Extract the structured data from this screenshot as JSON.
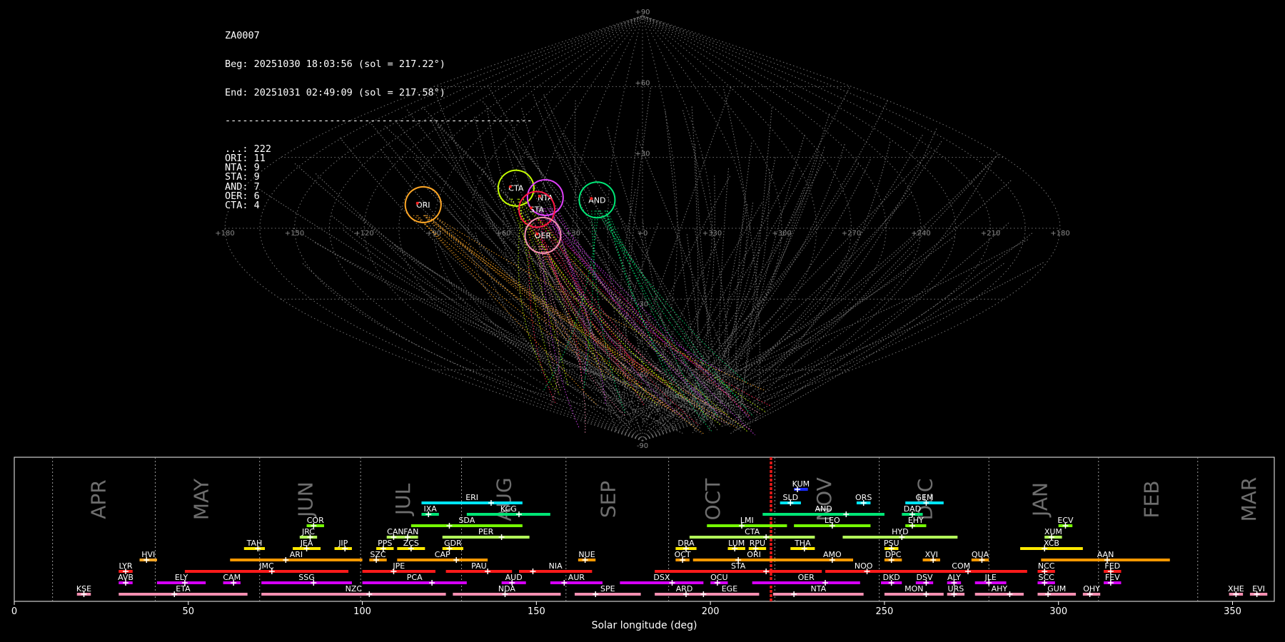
{
  "header": {
    "station": "ZA0007",
    "begin": "Beg: 20251030 18:03:56 (sol = 217.22°)",
    "end": "End: 20251031 02:49:09 (sol = 217.58°)",
    "separator": "-----------------------------------------------------",
    "counts": [
      {
        "label": "...",
        "count": 222
      },
      {
        "label": "ORI",
        "count": 11
      },
      {
        "label": "NTA",
        "count": 9
      },
      {
        "label": "STA",
        "count": 9
      },
      {
        "label": "AND",
        "count": 7
      },
      {
        "label": "OER",
        "count": 6
      },
      {
        "label": "CTA",
        "count": 4
      }
    ]
  },
  "chart_data": [
    {
      "type": "scatter",
      "projection": "sinusoidal",
      "lon_ticks": [
        "+180",
        "+150",
        "+120",
        "+90",
        "+60",
        "+30",
        "+0",
        "+330",
        "+300",
        "+270",
        "+240",
        "+210",
        "+180"
      ],
      "lat_ticks": [
        "+90",
        "+60",
        "+30",
        "-30",
        "-60",
        "-90"
      ],
      "radiants": [
        {
          "name": "ORI",
          "lon": 96,
          "lat": 10,
          "color": "#ffa726"
        },
        {
          "name": "CTA",
          "lon": 57,
          "lat": 17,
          "color": "#c6ff00"
        },
        {
          "name": "NTA",
          "lon": 43,
          "lat": 13,
          "color": "#e040fb"
        },
        {
          "name": "STA",
          "lon": 46,
          "lat": 8,
          "color": "#ff1744"
        },
        {
          "name": "AND",
          "lon": 20,
          "lat": 12,
          "color": "#00e676"
        },
        {
          "name": "OER",
          "lon": 43,
          "lat": -3,
          "color": "#f48fb1"
        }
      ]
    },
    {
      "type": "bar",
      "xlabel": "Solar longitude (deg)",
      "xlim": [
        0,
        362
      ],
      "xticks": [
        0,
        50,
        100,
        150,
        200,
        250,
        300,
        350
      ],
      "grid": true,
      "current_sol": [
        217.22,
        217.58
      ],
      "months": [
        {
          "name": "APR",
          "start": 11,
          "label": 24.5
        },
        {
          "name": "MAY",
          "start": 40.5,
          "label": 54
        },
        {
          "name": "JUN",
          "start": 70.5,
          "label": 84
        },
        {
          "name": "JUL",
          "start": 99.5,
          "label": 112
        },
        {
          "name": "AUG",
          "start": 128.5,
          "label": 141
        },
        {
          "name": "SEP",
          "start": 158.5,
          "label": 171
        },
        {
          "name": "OCT",
          "start": 188,
          "label": 201
        },
        {
          "name": "NOV",
          "start": 218.5,
          "label": 233
        },
        {
          "name": "DEC",
          "start": 248.5,
          "label": 262
        },
        {
          "name": "JAN",
          "start": 280,
          "label": 295
        },
        {
          "name": "FEB",
          "start": 311.5,
          "label": 327
        },
        {
          "name": "MAR",
          "start": 340,
          "label": 355
        }
      ],
      "showers": [
        {
          "code": "KUM",
          "start": 224,
          "end": 228,
          "peak": 225,
          "row": 0,
          "color": "#1a2bff"
        },
        {
          "code": "ERI",
          "start": 117,
          "end": 146,
          "peak": 137,
          "row": 1,
          "color": "#00e5ff"
        },
        {
          "code": "SLD",
          "start": 220,
          "end": 226,
          "peak": 223,
          "row": 1,
          "color": "#00e5ff"
        },
        {
          "code": "ORS",
          "start": 242,
          "end": 246,
          "peak": 244,
          "row": 1,
          "color": "#00e5ff"
        },
        {
          "code": "GEM",
          "start": 256,
          "end": 267,
          "peak": 262,
          "row": 1,
          "color": "#00e5ff"
        },
        {
          "code": "IXA",
          "start": 117,
          "end": 122,
          "peak": 119,
          "row": 2,
          "color": "#00e676"
        },
        {
          "code": "KCG",
          "start": 130,
          "end": 154,
          "peak": 145,
          "row": 2,
          "color": "#00e676"
        },
        {
          "code": "AND",
          "start": 215,
          "end": 250,
          "peak": 239,
          "row": 2,
          "color": "#00e676"
        },
        {
          "code": "DAD",
          "start": 255,
          "end": 261,
          "peak": 258,
          "row": 2,
          "color": "#00e676"
        },
        {
          "code": "COR",
          "start": 84,
          "end": 89,
          "peak": 86,
          "row": 3,
          "color": "#76ff03"
        },
        {
          "code": "SDA",
          "start": 114,
          "end": 146,
          "peak": 125,
          "row": 3,
          "color": "#76ff03"
        },
        {
          "code": "LMI",
          "start": 199,
          "end": 222,
          "peak": 209,
          "row": 3,
          "color": "#76ff03"
        },
        {
          "code": "LEO",
          "start": 224,
          "end": 246,
          "peak": 235,
          "row": 3,
          "color": "#76ff03"
        },
        {
          "code": "EHY",
          "start": 256,
          "end": 262,
          "peak": 258,
          "row": 3,
          "color": "#76ff03"
        },
        {
          "code": "ECV",
          "start": 300,
          "end": 304,
          "peak": 302,
          "row": 3,
          "color": "#76ff03"
        },
        {
          "code": "JRC",
          "start": 82,
          "end": 87,
          "peak": 85,
          "row": 4,
          "color": "#b2ff59"
        },
        {
          "code": "CAN",
          "start": 107,
          "end": 112,
          "peak": 109,
          "row": 4,
          "color": "#b2ff59"
        },
        {
          "code": "FAN",
          "start": 112,
          "end": 116,
          "peak": 113,
          "row": 4,
          "color": "#b2ff59"
        },
        {
          "code": "PER",
          "start": 123,
          "end": 148,
          "peak": 140,
          "row": 4,
          "color": "#b2ff59"
        },
        {
          "code": "CTA",
          "start": 194,
          "end": 230,
          "peak": 216,
          "row": 4,
          "color": "#b2ff59"
        },
        {
          "code": "HYD",
          "start": 238,
          "end": 271,
          "peak": 255,
          "row": 4,
          "color": "#b2ff59"
        },
        {
          "code": "XUM",
          "start": 296,
          "end": 301,
          "peak": 298,
          "row": 4,
          "color": "#b2ff59"
        },
        {
          "code": "TAH",
          "start": 66,
          "end": 72,
          "peak": 70,
          "row": 5,
          "color": "#ffea00"
        },
        {
          "code": "JEA",
          "start": 80,
          "end": 88,
          "peak": 84,
          "row": 5,
          "color": "#ffea00"
        },
        {
          "code": "JIP",
          "start": 92,
          "end": 97,
          "peak": 95,
          "row": 5,
          "color": "#ffea00"
        },
        {
          "code": "PPS",
          "start": 104,
          "end": 109,
          "peak": 106,
          "row": 5,
          "color": "#ffea00"
        },
        {
          "code": "ZCS",
          "start": 110,
          "end": 118,
          "peak": 114,
          "row": 5,
          "color": "#ffea00"
        },
        {
          "code": "GDR",
          "start": 123,
          "end": 129,
          "peak": 125,
          "row": 5,
          "color": "#ffea00"
        },
        {
          "code": "DRA",
          "start": 190,
          "end": 196,
          "peak": 193,
          "row": 5,
          "color": "#ffea00"
        },
        {
          "code": "LUM",
          "start": 205,
          "end": 210,
          "peak": 207,
          "row": 5,
          "color": "#ffea00"
        },
        {
          "code": "RPU",
          "start": 211,
          "end": 216,
          "peak": 213,
          "row": 5,
          "color": "#ffea00"
        },
        {
          "code": "THA",
          "start": 223,
          "end": 230,
          "peak": 227,
          "row": 5,
          "color": "#ffea00"
        },
        {
          "code": "PSU",
          "start": 250,
          "end": 254,
          "peak": 252,
          "row": 5,
          "color": "#ffea00"
        },
        {
          "code": "XCB",
          "start": 289,
          "end": 307,
          "peak": 296,
          "row": 5,
          "color": "#ffea00"
        },
        {
          "code": "HVI",
          "start": 36,
          "end": 41,
          "peak": 38,
          "row": 6,
          "color": "#ffa726"
        },
        {
          "code": "ARI",
          "start": 62,
          "end": 100,
          "peak": 78,
          "row": 6,
          "color": "#ff9800"
        },
        {
          "code": "SZC",
          "start": 102,
          "end": 107,
          "peak": 104,
          "row": 6,
          "color": "#ff9800"
        },
        {
          "code": "CAP",
          "start": 110,
          "end": 136,
          "peak": 127,
          "row": 6,
          "color": "#ff9800"
        },
        {
          "code": "NUE",
          "start": 162,
          "end": 167,
          "peak": 164,
          "row": 6,
          "color": "#ff9800"
        },
        {
          "code": "OCT",
          "start": 190,
          "end": 194,
          "peak": 192,
          "row": 6,
          "color": "#ff9800"
        },
        {
          "code": "ORI",
          "start": 195,
          "end": 230,
          "peak": 208,
          "row": 6,
          "color": "#ff9800"
        },
        {
          "code": "AMO",
          "start": 229,
          "end": 241,
          "peak": 235,
          "row": 6,
          "color": "#ff9800"
        },
        {
          "code": "DPC",
          "start": 250,
          "end": 255,
          "peak": 252,
          "row": 6,
          "color": "#ff9800"
        },
        {
          "code": "XVI",
          "start": 261,
          "end": 266,
          "peak": 264,
          "row": 6,
          "color": "#ff9800"
        },
        {
          "code": "QUA",
          "start": 275,
          "end": 280,
          "peak": 278,
          "row": 6,
          "color": "#ff9800"
        },
        {
          "code": "AAN",
          "start": 295,
          "end": 332,
          "peak": 314,
          "row": 6,
          "color": "#ff9800"
        },
        {
          "code": "LYR",
          "start": 30,
          "end": 34,
          "peak": 32,
          "row": 7,
          "color": "#ff1a1a"
        },
        {
          "code": "JMC",
          "start": 49,
          "end": 96,
          "peak": 74,
          "row": 7,
          "color": "#ff1a1a"
        },
        {
          "code": "JPE",
          "start": 100,
          "end": 121,
          "peak": 109,
          "row": 7,
          "color": "#ff1a1a"
        },
        {
          "code": "PAU",
          "start": 124,
          "end": 143,
          "peak": 136,
          "row": 7,
          "color": "#ff1a1a"
        },
        {
          "code": "NIA",
          "start": 145,
          "end": 166,
          "peak": 149,
          "row": 7,
          "color": "#ff1a1a"
        },
        {
          "code": "STA",
          "start": 184,
          "end": 232,
          "peak": 216,
          "row": 7,
          "color": "#ff1a1a"
        },
        {
          "code": "NOO",
          "start": 233,
          "end": 255,
          "peak": 245,
          "row": 7,
          "color": "#ff1a1a"
        },
        {
          "code": "COM",
          "start": 253,
          "end": 291,
          "peak": 274,
          "row": 7,
          "color": "#ff1a1a"
        },
        {
          "code": "NCC",
          "start": 294,
          "end": 299,
          "peak": 296,
          "row": 7,
          "color": "#ff1a1a"
        },
        {
          "code": "FED",
          "start": 313,
          "end": 318,
          "peak": 315,
          "row": 7,
          "color": "#ff1a1a"
        },
        {
          "code": "AVB",
          "start": 30,
          "end": 34,
          "peak": 32,
          "row": 8,
          "color": "#d500f9"
        },
        {
          "code": "ELY",
          "start": 41,
          "end": 55,
          "peak": 49,
          "row": 8,
          "color": "#d500f9"
        },
        {
          "code": "CAM",
          "start": 60,
          "end": 65,
          "peak": 63,
          "row": 8,
          "color": "#d500f9"
        },
        {
          "code": "SSG",
          "start": 71,
          "end": 97,
          "peak": 86,
          "row": 8,
          "color": "#d500f9"
        },
        {
          "code": "PCA",
          "start": 100,
          "end": 130,
          "peak": 120,
          "row": 8,
          "color": "#d500f9"
        },
        {
          "code": "AUD",
          "start": 140,
          "end": 147,
          "peak": 143,
          "row": 8,
          "color": "#d500f9"
        },
        {
          "code": "AUR",
          "start": 154,
          "end": 169,
          "peak": 158,
          "row": 8,
          "color": "#d500f9"
        },
        {
          "code": "DSX",
          "start": 174,
          "end": 198,
          "peak": 189,
          "row": 8,
          "color": "#d500f9"
        },
        {
          "code": "OCU",
          "start": 200,
          "end": 205,
          "peak": 202,
          "row": 8,
          "color": "#d500f9"
        },
        {
          "code": "OER",
          "start": 212,
          "end": 243,
          "peak": 233,
          "row": 8,
          "color": "#d500f9"
        },
        {
          "code": "DKD",
          "start": 249,
          "end": 255,
          "peak": 252,
          "row": 8,
          "color": "#d500f9"
        },
        {
          "code": "DSV",
          "start": 259,
          "end": 264,
          "peak": 262,
          "row": 8,
          "color": "#d500f9"
        },
        {
          "code": "ALY",
          "start": 268,
          "end": 272,
          "peak": 270,
          "row": 8,
          "color": "#d500f9"
        },
        {
          "code": "JLE",
          "start": 276,
          "end": 285,
          "peak": 280,
          "row": 8,
          "color": "#d500f9"
        },
        {
          "code": "SCC",
          "start": 294,
          "end": 299,
          "peak": 296,
          "row": 8,
          "color": "#d500f9"
        },
        {
          "code": "FEV",
          "start": 313,
          "end": 318,
          "peak": 315,
          "row": 8,
          "color": "#d500f9"
        },
        {
          "code": "KSE",
          "start": 18,
          "end": 22,
          "peak": 20,
          "row": 9,
          "color": "#f48fb1"
        },
        {
          "code": "ETA",
          "start": 30,
          "end": 67,
          "peak": 46,
          "row": 9,
          "color": "#f48fb1"
        },
        {
          "code": "NZC",
          "start": 71,
          "end": 124,
          "peak": 102,
          "row": 9,
          "color": "#f48fb1"
        },
        {
          "code": "NDA",
          "start": 126,
          "end": 157,
          "peak": 141,
          "row": 9,
          "color": "#f48fb1"
        },
        {
          "code": "SPE",
          "start": 161,
          "end": 180,
          "peak": 167,
          "row": 9,
          "color": "#f48fb1"
        },
        {
          "code": "ARD",
          "start": 184,
          "end": 201,
          "peak": 193,
          "row": 9,
          "color": "#f48fb1"
        },
        {
          "code": "EGE",
          "start": 197,
          "end": 214,
          "peak": 198,
          "row": 9,
          "color": "#f48fb1"
        },
        {
          "code": "NTA",
          "start": 218,
          "end": 244,
          "peak": 224,
          "row": 9,
          "color": "#f48fb1"
        },
        {
          "code": "MON",
          "start": 250,
          "end": 267,
          "peak": 262,
          "row": 9,
          "color": "#f48fb1"
        },
        {
          "code": "URS",
          "start": 268,
          "end": 273,
          "peak": 270,
          "row": 9,
          "color": "#f48fb1"
        },
        {
          "code": "AHY",
          "start": 276,
          "end": 290,
          "peak": 286,
          "row": 9,
          "color": "#f48fb1"
        },
        {
          "code": "GUM",
          "start": 294,
          "end": 305,
          "peak": 297,
          "row": 9,
          "color": "#f48fb1"
        },
        {
          "code": "OHY",
          "start": 307,
          "end": 312,
          "peak": 309,
          "row": 9,
          "color": "#f48fb1"
        },
        {
          "code": "XHE",
          "start": 349,
          "end": 353,
          "peak": 351,
          "row": 9,
          "color": "#f48fb1"
        },
        {
          "code": "EVI",
          "start": 355,
          "end": 360,
          "peak": 357,
          "row": 9,
          "color": "#f48fb1"
        }
      ]
    }
  ]
}
